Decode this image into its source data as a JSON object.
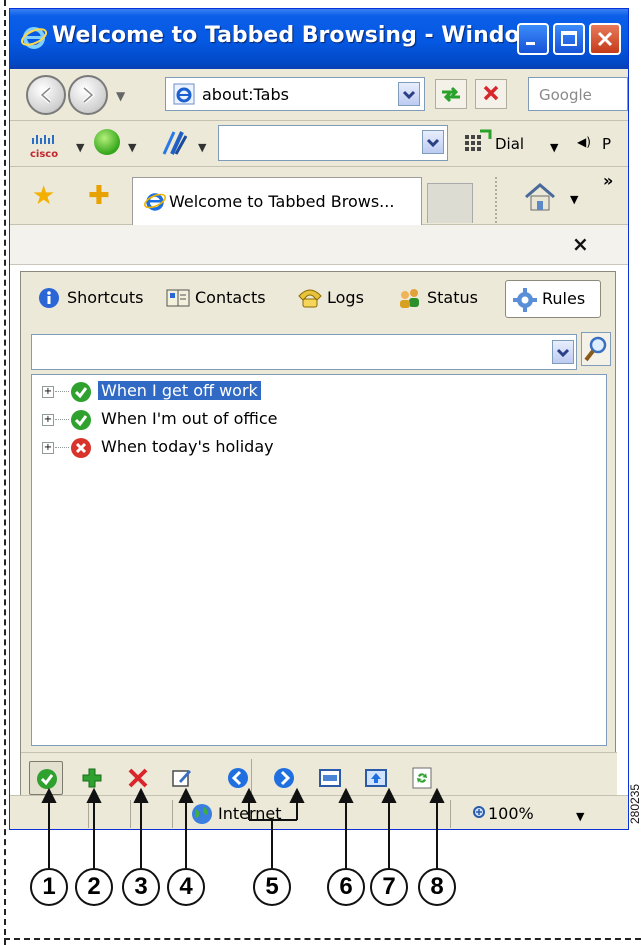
{
  "window": {
    "title": "Welcome to Tabbed Browsing - Windo..."
  },
  "address_bar": {
    "value": "about:Tabs"
  },
  "search_box": {
    "placeholder": "Google"
  },
  "links_toolbar": {
    "cisco_logo_text": "cisco",
    "dial_label": "Dial",
    "p_label": "P"
  },
  "tabs": [
    {
      "label": "Welcome to Tabbed Brows..."
    }
  ],
  "tabs_overflow": "»",
  "close_glyph": "×",
  "panel": {
    "tabs": [
      {
        "label": "Shortcuts",
        "icon": "info-icon"
      },
      {
        "label": "Contacts",
        "icon": "address-book-icon"
      },
      {
        "label": "Logs",
        "icon": "phone-log-icon"
      },
      {
        "label": "Status",
        "icon": "people-status-icon"
      },
      {
        "label": "Rules",
        "icon": "gear-icon",
        "active": true
      }
    ],
    "filter_value": "",
    "rules": [
      {
        "label": "When I get off work",
        "status": "enabled",
        "selected": true
      },
      {
        "label": "When I'm out of office",
        "status": "enabled",
        "selected": false
      },
      {
        "label": "When today's holiday",
        "status": "disabled",
        "selected": false
      }
    ],
    "toolbar_icons": [
      "enable-rule-icon",
      "add-rule-icon",
      "delete-rule-icon",
      "edit-rule-icon",
      "move-up-icon",
      "move-down-icon",
      "import-icon",
      "export-icon",
      "refresh-icon"
    ]
  },
  "status_bar": {
    "zone": "Internet",
    "zoom": "100%"
  },
  "callouts": [
    "1",
    "2",
    "3",
    "4",
    "5",
    "6",
    "7",
    "8"
  ],
  "figure_id": "280235",
  "colors": {
    "titlebar": "#0558e2",
    "selection": "#316ac5",
    "chrome": "#ece9d8",
    "enabled_green": "#2ea12e",
    "disabled_red": "#d9342b",
    "action_blue": "#1f6fe0"
  }
}
